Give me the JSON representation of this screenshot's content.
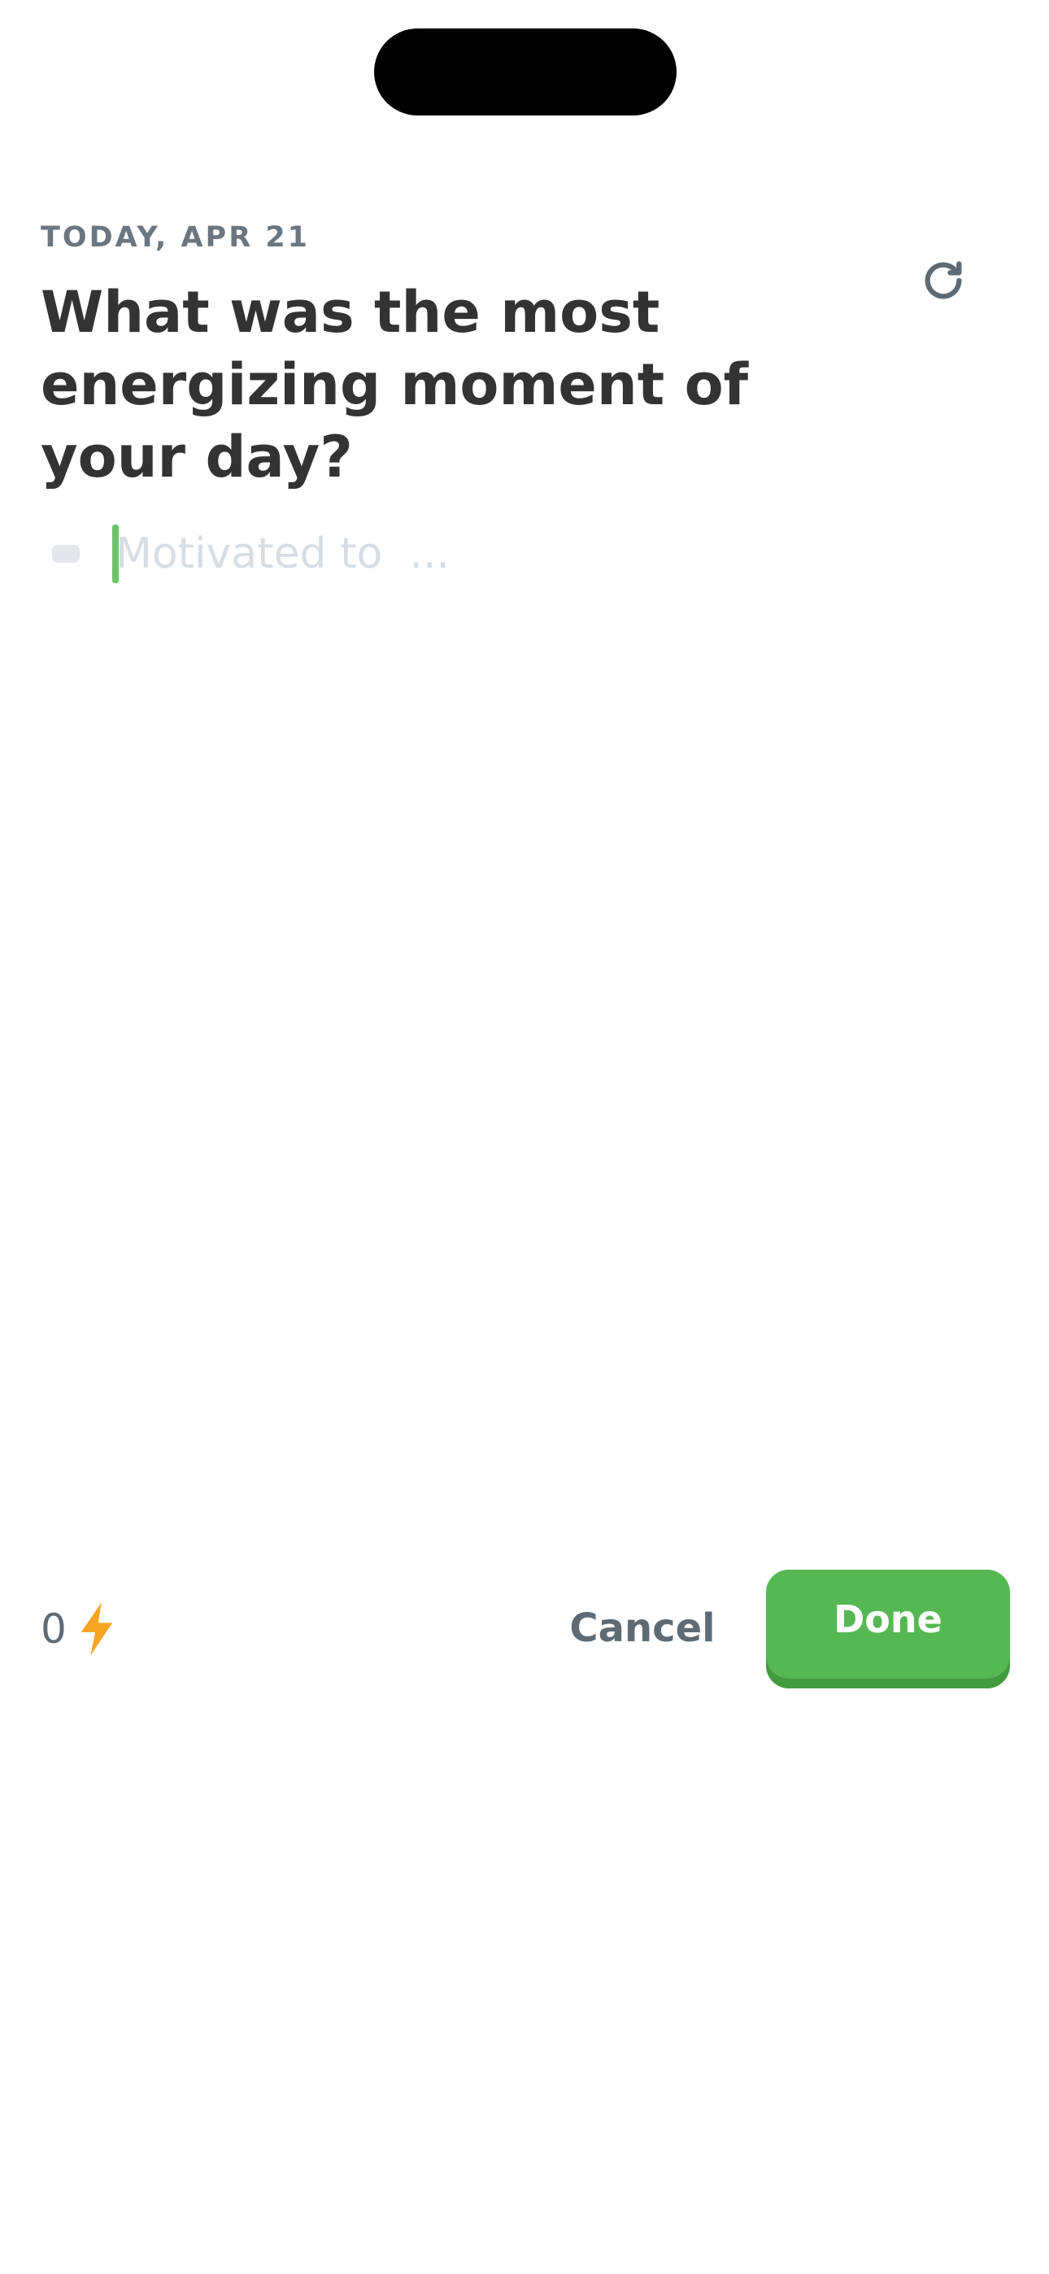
{
  "header": {
    "date_label": "TODAY, APR 21",
    "refresh_icon": "refresh-icon"
  },
  "prompt": {
    "question": "What was the most energizing moment of your day?"
  },
  "entry": {
    "value": "",
    "placeholder": "Motivated to  ..."
  },
  "footer": {
    "energy_count": "0",
    "energy_icon": "lightning-bolt-icon",
    "cancel_label": "Cancel",
    "done_label": "Done"
  },
  "colors": {
    "accent_green": "#56b853",
    "accent_green_shadow": "#439b40",
    "caret_green": "#6cc36a",
    "bolt_orange": "#f5a623",
    "text_dark": "#333333",
    "text_muted": "#6b7680",
    "placeholder": "#d6dde3"
  }
}
